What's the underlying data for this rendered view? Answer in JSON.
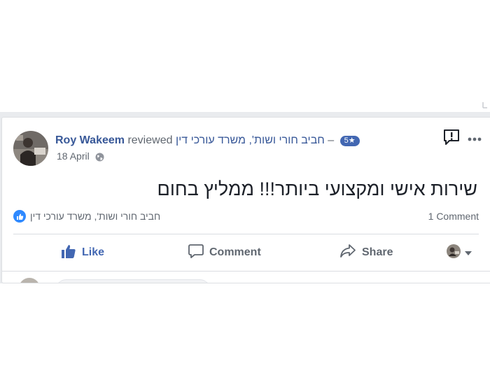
{
  "post": {
    "author": "Roy Wakeem",
    "verb": "reviewed",
    "page_name": "חביב חורי ושות', משרד עורכי דין",
    "dash": "–",
    "rating": "5★",
    "date": "18 April",
    "review_text": "שירות אישי ומקצועי ביותר!!! ממליץ בחום",
    "reactors": "חביב חורי ושות', משרד עורכי דין",
    "comment_count": "1 Comment"
  },
  "actions": {
    "like": "Like",
    "comment": "Comment",
    "share": "Share"
  },
  "icons": {
    "globe": "globe-icon",
    "report": "report-icon",
    "more": "more-icon",
    "like_badge": "thumbs-up-icon",
    "like_action": "thumbs-up-icon",
    "comment_action": "comment-icon",
    "share_action": "share-icon",
    "audience": "avatar-dropdown"
  },
  "colors": {
    "brand": "#4267b2",
    "link": "#385898",
    "like_badge": "#2e89ff",
    "muted": "#606770",
    "background": "#e9ebee"
  }
}
